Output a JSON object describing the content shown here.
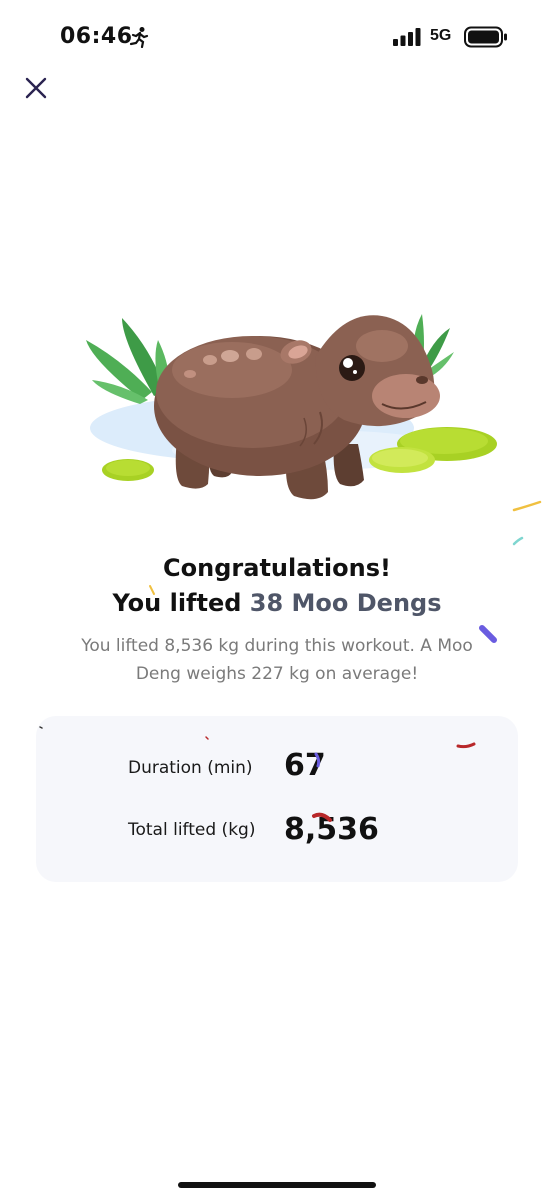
{
  "status_bar": {
    "time": "06:46",
    "network": "5G"
  },
  "icons": {
    "close": "close-icon",
    "activity": "running-icon"
  },
  "illustration": {
    "subject": "pygmy-hippo-illustration"
  },
  "celebration": {
    "title": "Congratulations!",
    "lifted_prefix": "You lifted ",
    "lifted_highlight": "38 Moo Dengs",
    "description": "You lifted 8,536 kg during this workout. A Moo Deng weighs 227 kg on average!"
  },
  "stats": [
    {
      "label": "Duration (min)",
      "value": "67"
    },
    {
      "label": "Total lifted (kg)",
      "value": "8,536"
    }
  ],
  "colors": {
    "highlight": "#4f5668",
    "card_bg": "#f6f7fb",
    "close_icon": "#2a2350"
  }
}
